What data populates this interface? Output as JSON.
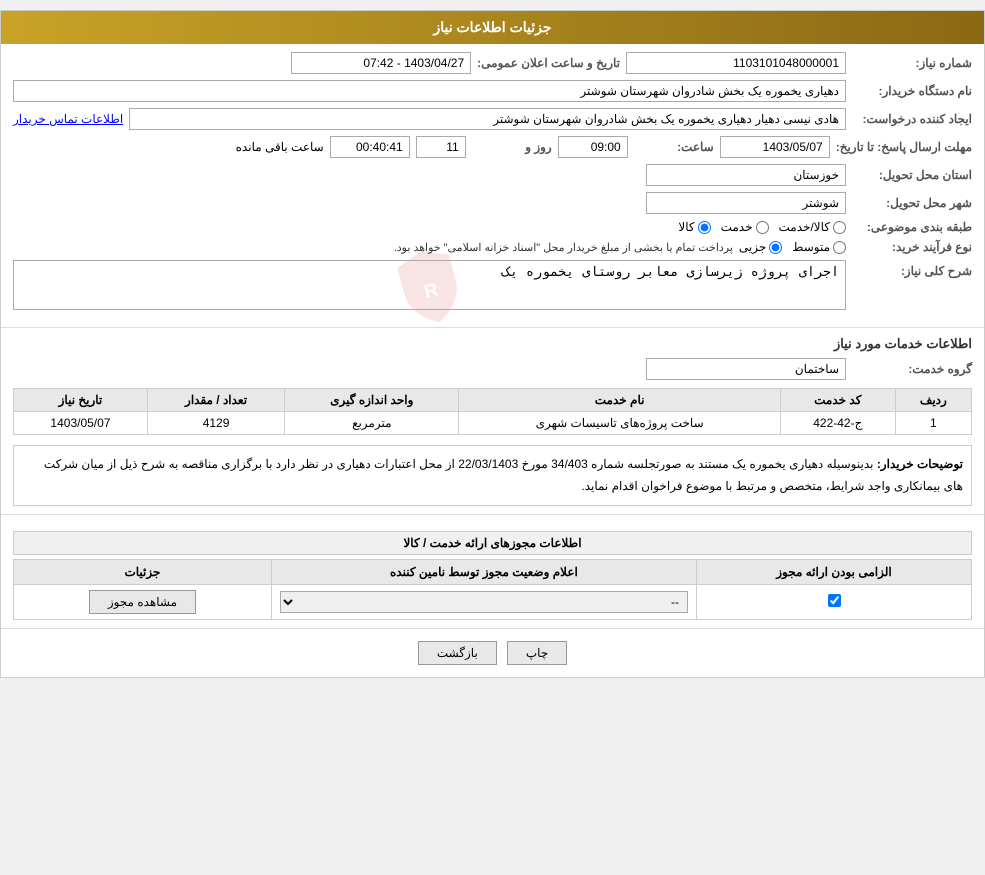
{
  "header": {
    "title": "جزئیات اطلاعات نیاز"
  },
  "info": {
    "need_number_label": "شماره نیاز:",
    "need_number_value": "1103101048000001",
    "buyer_org_label": "نام دستگاه خریدار:",
    "buyer_org_value": "دهیاری یخموره یک بخش شادروان شهرستان شوشتر",
    "date_time_label": "تاریخ و ساعت اعلان عمومی:",
    "date_time_value": "1403/04/27 - 07:42",
    "creator_label": "ایجاد کننده درخواست:",
    "creator_value": "هادی نیسی دهیار دهیاری یخموره یک بخش شادروان شهرستان شوشتر",
    "contact_link": "اطلاعات تماس خریدار",
    "deadline_label": "مهلت ارسال پاسخ: تا تاریخ:",
    "deadline_date": "1403/05/07",
    "deadline_time_label": "ساعت:",
    "deadline_time": "09:00",
    "deadline_day_label": "روز و",
    "deadline_day": "11",
    "deadline_remaining_label": "ساعت باقی مانده",
    "deadline_remaining": "00:40:41",
    "province_label": "استان محل تحویل:",
    "province_value": "خوزستان",
    "city_label": "شهر محل تحویل:",
    "city_value": "شوشتر",
    "category_label": "طبقه بندی موضوعی:",
    "category_options": [
      "کالا",
      "خدمت",
      "کالا/خدمت"
    ],
    "category_selected": "کالا",
    "purchase_type_label": "نوع فرآیند خرید:",
    "purchase_types": [
      "جزیی",
      "متوسط"
    ],
    "purchase_note": "پرداخت تمام یا بخشی از مبلغ خریدار محل \"اسناد خزانه اسلامی\" خواهد بود.",
    "need_desc_label": "شرح کلی نیاز:",
    "need_desc_value": "اجرای پروژه زیرسازی معابر روستای یخموره یک"
  },
  "services": {
    "title": "اطلاعات خدمات مورد نیاز",
    "service_group_label": "گروه خدمت:",
    "service_group_value": "ساختمان",
    "table": {
      "headers": [
        "ردیف",
        "کد خدمت",
        "نام خدمت",
        "واحد اندازه گیری",
        "تعداد / مقدار",
        "تاریخ نیاز"
      ],
      "rows": [
        [
          "1",
          "ج-42-422",
          "ساخت پروژه‌های تاسیسات شهری",
          "مترمربع",
          "4129",
          "1403/05/07"
        ]
      ]
    },
    "buyer_desc_label": "توضیحات خریدار:",
    "buyer_desc_value": "بدینوسیله دهیاری یخموره یک مستند به صورتجلسه شماره 34/403 مورخ 22/03/1403 از محل اعتبارات دهیاری در نظر دارد با برگزاری مناقصه به شرح ذیل از میان شرکت های بیمانکاری واجد شرایط، متخصص و مرتبط با موضوع فراخوان اقدام نماید."
  },
  "permits": {
    "section_title": "اطلاعات مجوزهای ارائه خدمت / کالا",
    "table": {
      "headers": [
        "الزامی بودن ارائه مجوز",
        "اعلام وضعیت مجوز توسط نامین کننده",
        "جزئیات"
      ],
      "rows": [
        {
          "required": true,
          "status_options": [
            "--"
          ],
          "status_selected": "--",
          "detail_btn": "مشاهده مجوز"
        }
      ]
    }
  },
  "buttons": {
    "back": "بازگشت",
    "print": "چاپ"
  }
}
